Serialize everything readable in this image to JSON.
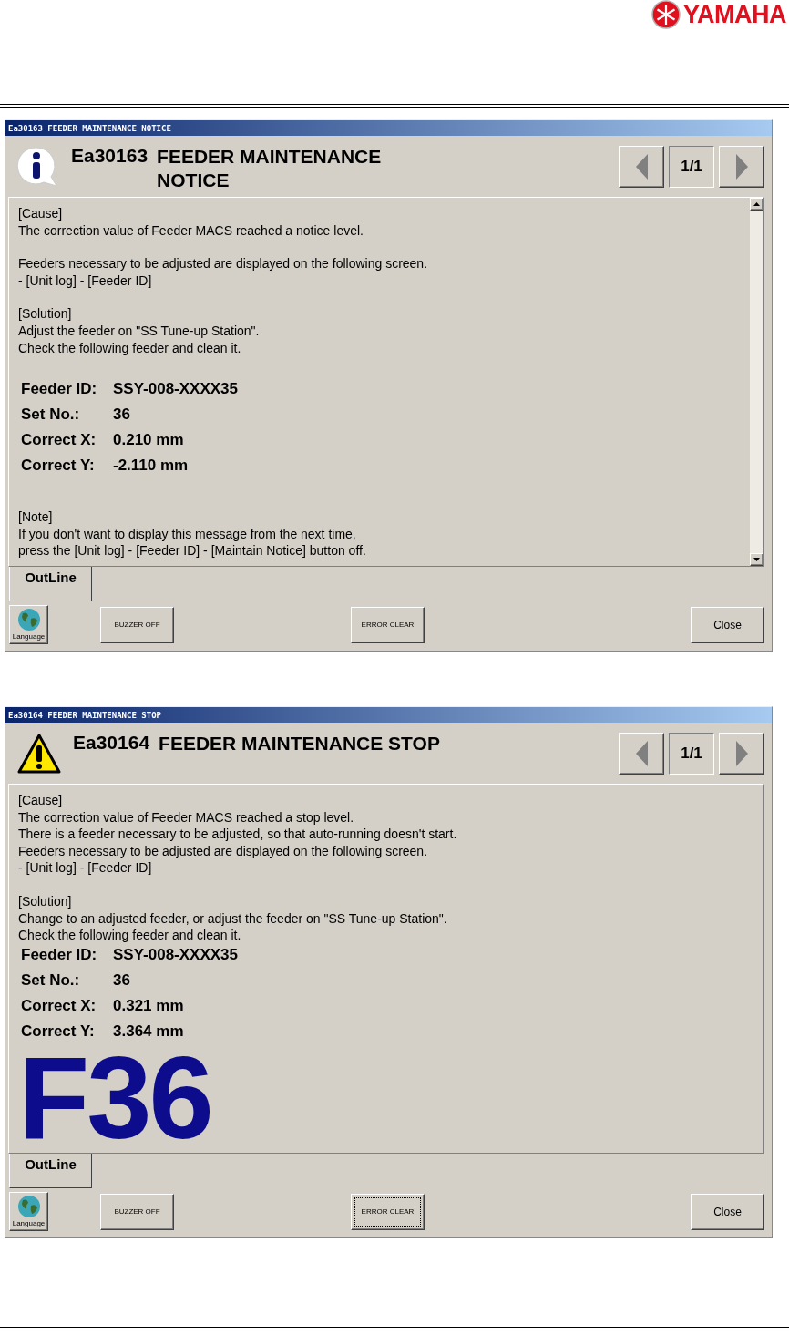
{
  "logo": {
    "text": "YAMAHA"
  },
  "windows": [
    {
      "title": "Ea30163 FEEDER MAINTENANCE NOTICE",
      "kind": "info",
      "code": "Ea30163",
      "heading": "FEEDER MAINTENANCE\nNOTICE",
      "pager": "1/1",
      "scrollable": true,
      "blocks": [
        {
          "kind": "text",
          "text": "[Cause]\nThe correction value of Feeder MACS reached a notice level."
        },
        {
          "kind": "text",
          "text": "Feeders necessary to be adjusted are displayed on the following screen.\n- [Unit log] - [Feeder ID]"
        },
        {
          "kind": "text",
          "text": "[Solution]\nAdjust the feeder on \"SS Tune-up Station\".\nCheck the following feeder and clean it."
        },
        {
          "kind": "details",
          "rows": [
            {
              "label": "Feeder ID:",
              "value": "SSY-008-XXXX35"
            },
            {
              "label": "Set No.:",
              "value": "36"
            },
            {
              "label": "Correct X:",
              "value": "0.210 mm"
            },
            {
              "label": "Correct Y:",
              "value": "-2.110 mm"
            }
          ]
        },
        {
          "kind": "text",
          "text": "[Note]\nIf you don't want to display this message from the next time,\npress the  [Unit log] - [Feeder ID] - [Maintain Notice] button off."
        }
      ],
      "tabs": [
        {
          "label": "OutLine",
          "selected": true
        }
      ],
      "language": "Language",
      "buttons": [
        {
          "label": "BUZZER OFF",
          "kind": "small",
          "focused": false
        },
        {
          "label": "ERROR CLEAR",
          "kind": "small",
          "focused": false
        },
        {
          "label": "Close",
          "kind": "close",
          "focused": false
        }
      ]
    },
    {
      "title": "Ea30164 FEEDER MAINTENANCE STOP",
      "kind": "warning",
      "code": "Ea30164",
      "heading": "FEEDER MAINTENANCE STOP",
      "pager": "1/1",
      "scrollable": false,
      "blocks": [
        {
          "kind": "text",
          "text": "[Cause]\nThe correction value of Feeder MACS reached a stop level.\nThere is a feeder necessary to be adjusted, so that auto-running doesn't start.\nFeeders necessary to be adjusted are displayed on the following screen.\n- [Unit log] - [Feeder ID]"
        },
        {
          "kind": "text",
          "text": "[Solution]\nChange to an adjusted feeder, or adjust the feeder on \"SS Tune-up Station\".\nCheck the following feeder and clean it."
        },
        {
          "kind": "details",
          "rows": [
            {
              "label": "Feeder ID:",
              "value": "SSY-008-XXXX35"
            },
            {
              "label": "Set No.:",
              "value": "36"
            },
            {
              "label": "Correct X:",
              "value": "0.321 mm"
            },
            {
              "label": "Correct Y:",
              "value": "3.364 mm"
            }
          ]
        },
        {
          "kind": "big",
          "text": "F36"
        }
      ],
      "tabs": [
        {
          "label": "OutLine",
          "selected": true
        }
      ],
      "language": "Language",
      "buttons": [
        {
          "label": "BUZZER OFF",
          "kind": "small",
          "focused": false
        },
        {
          "label": "ERROR CLEAR",
          "kind": "small",
          "focused": true
        },
        {
          "label": "Close",
          "kind": "close",
          "focused": false
        }
      ]
    }
  ]
}
